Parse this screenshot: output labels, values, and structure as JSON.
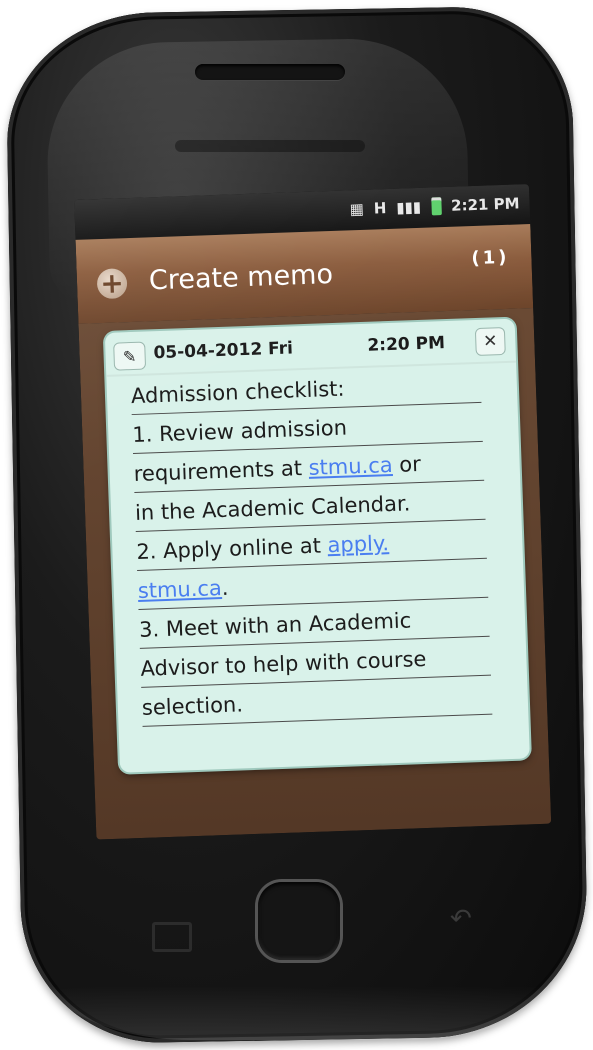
{
  "status_bar": {
    "network": "H",
    "time": "2:21 PM"
  },
  "app": {
    "title": "Create memo",
    "count": "(1)"
  },
  "memo": {
    "date": "05-04-2012 Fri",
    "time": "2:20 PM",
    "lines": [
      {
        "text": "Admission checklist:"
      },
      {
        "text": "1. Review admission"
      },
      {
        "prefix": "requirements at ",
        "link": "stmu.ca",
        "suffix": " or"
      },
      {
        "text": "in the Academic Calendar."
      },
      {
        "prefix": "2. Apply online at ",
        "link": "apply."
      },
      {
        "link": "stmu.ca",
        "suffix": "."
      },
      {
        "text": "3. Meet with an Academic"
      },
      {
        "text": "Advisor to help with course"
      },
      {
        "text": "selection."
      }
    ]
  },
  "icons": {
    "add": "plus-icon",
    "edit": "pencil-icon",
    "close": "close-icon",
    "back": "back-arrow-icon",
    "menu": "menu-icon"
  },
  "colors": {
    "title_bar": "#8b5c3d",
    "memo_bg": "#d9f2ea",
    "link": "#4a7ef0"
  }
}
